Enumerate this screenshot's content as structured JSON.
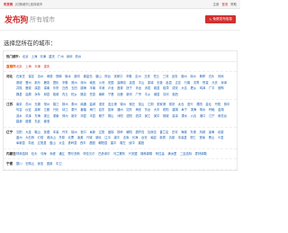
{
  "topbar": {
    "logo": "布发网",
    "left_links": "[切换城市] 选择城市",
    "right_links": [
      "注册",
      "登录",
      "帮助"
    ]
  },
  "header": {
    "brand": "发布狗",
    "brand_sub": "所有城市",
    "post_button": "免费发布信息"
  },
  "page_title": "选择您所在的城市：",
  "hot": {
    "label": "热门城市：",
    "cities": [
      "北京",
      "上海",
      "天津",
      "重庆",
      "广州",
      "深圳",
      "杭州"
    ]
  },
  "provinces": [
    {
      "name": "直辖市",
      "cities": [
        "北京",
        "上海",
        "天津",
        "重庆"
      ]
    },
    {
      "name": "河北",
      "cities": [
        "石家庄",
        "保定",
        "沧州",
        "承德",
        "邯郸",
        "衡水",
        "廊坊",
        "秦皇岛",
        "唐山",
        "邢台",
        "张家口",
        "辛集",
        "定州",
        "迁安",
        "任丘",
        "三河",
        "武安",
        "霸州",
        "涿州",
        "黄骅",
        "泊头",
        "河间",
        "藁城",
        "晋州",
        "新乐",
        "鹿泉",
        "遵化",
        "辛集",
        "冀州",
        "深州",
        "南宫",
        "沙河",
        "安国",
        "高碑店",
        "高邑",
        "平山",
        "栾城",
        "无极",
        "赵县",
        "正定",
        "行唐",
        "灵寿",
        "赞皇",
        "元氏",
        "深泽",
        "井陉",
        "鹿泉",
        "滦县",
        "滦南",
        "乐亭",
        "迁西",
        "玉田",
        "唐海",
        "丰南",
        "丰润",
        "卢龙",
        "昌黎",
        "抚宁",
        "青龙",
        "涉县",
        "磁县",
        "临漳",
        "成安",
        "大名",
        "肥乡",
        "鸡泽",
        "广平",
        "馆陶",
        "魏县",
        "曲周",
        "永年",
        "邱县",
        "临城",
        "内丘",
        "柏乡",
        "隆尧",
        "任县",
        "南和",
        "宁晋",
        "巨鹿",
        "新河",
        "广宗",
        "平乡",
        "威县",
        "清河",
        "临西"
      ]
    },
    {
      "name": "江苏",
      "cities": [
        "南京",
        "苏州",
        "无锡",
        "常州",
        "镇江",
        "扬州",
        "泰州",
        "南通",
        "盐城",
        "淮安",
        "连云港",
        "徐州",
        "宿迁",
        "昆山",
        "江阴",
        "张家港",
        "常熟",
        "太仓",
        "宜兴",
        "溧阳",
        "金坛",
        "丹阳",
        "扬中",
        "句容",
        "仪征",
        "高邮",
        "江都",
        "兴化",
        "靖江",
        "泰兴",
        "姜堰",
        "海门",
        "启东",
        "如皋",
        "通州",
        "如东",
        "海安",
        "东台",
        "大丰",
        "射阳",
        "建湖",
        "阜宁",
        "滨海",
        "响水",
        "盱眙",
        "金湖",
        "涟水",
        "洪泽",
        "东海",
        "灌云",
        "灌南",
        "邳州",
        "新沂",
        "沛县",
        "丰县",
        "睢宁",
        "铜山",
        "沭阳",
        "泗阳",
        "泗洪",
        "吴江",
        "吴中",
        "相城",
        "高淳",
        "溧水",
        "六合",
        "浦口",
        "江宁",
        "雨花台",
        "建邺",
        "鼓楼",
        "玄武",
        "秦淮"
      ]
    },
    {
      "name": "辽宁",
      "cities": [
        "沈阳",
        "大连",
        "鞍山",
        "抚顺",
        "本溪",
        "丹东",
        "锦州",
        "营口",
        "阜新",
        "辽阳",
        "盘锦",
        "铁岭",
        "朝阳",
        "葫芦岛",
        "瓦房店",
        "普兰店",
        "庄河",
        "海城",
        "东港",
        "凤城",
        "凌海",
        "北镇",
        "盖州",
        "大石桥",
        "灯塔",
        "调兵山",
        "开原",
        "北票",
        "凌源",
        "兴城",
        "新民",
        "辽中",
        "康平",
        "法库",
        "长海",
        "台安",
        "岫岩",
        "新宾",
        "清原",
        "本溪县",
        "桓仁",
        "宽甸",
        "黑山",
        "义县",
        "阜新县",
        "彰武",
        "辽阳县",
        "盘山",
        "大洼",
        "铁岭县",
        "西丰",
        "昌图",
        "朝阳县",
        "建平",
        "喀左",
        "绥中",
        "建昌"
      ]
    },
    {
      "name": "内蒙古",
      "cities": [
        "呼和浩特",
        "包头",
        "乌海",
        "赤峰",
        "通辽",
        "鄂尔多斯",
        "呼伦贝尔",
        "巴彦淖尔",
        "乌兰察布",
        "兴安盟",
        "锡林郭勒",
        "阿拉善",
        "满洲里",
        "二连浩特",
        "霍林郭勒"
      ]
    },
    {
      "name": "宁夏",
      "cities": [
        "银川",
        "石嘴山",
        "吴忠",
        "固原",
        "中卫"
      ]
    }
  ]
}
